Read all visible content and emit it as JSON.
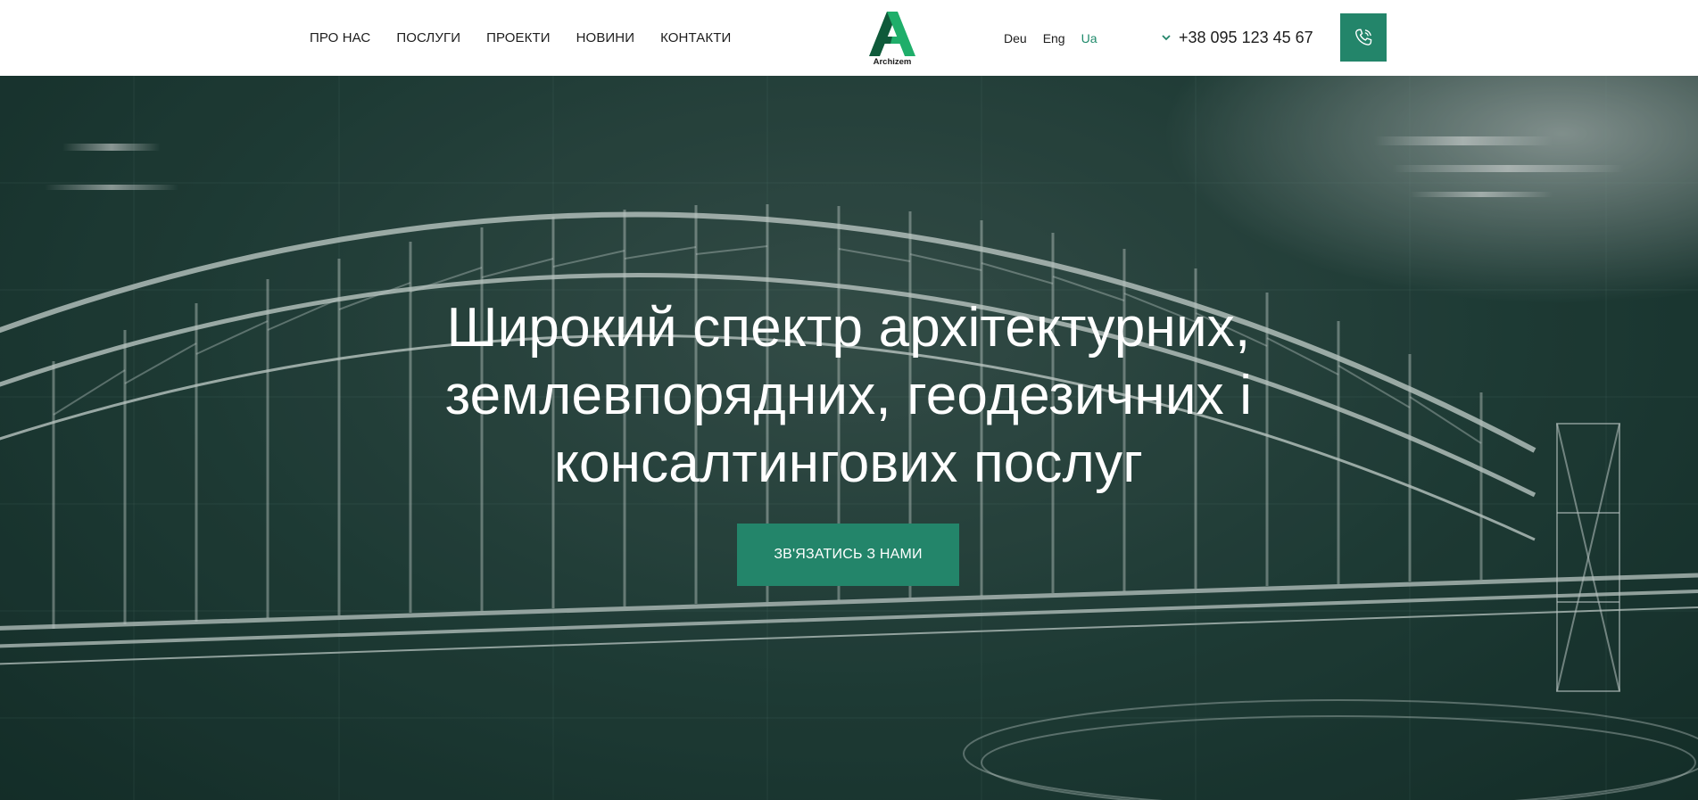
{
  "nav": {
    "items": [
      {
        "label": "ПРО НАС"
      },
      {
        "label": "ПОСЛУГИ"
      },
      {
        "label": "ПРОЕКТИ"
      },
      {
        "label": "НОВИНИ"
      },
      {
        "label": "КОНТАКТИ"
      }
    ]
  },
  "logo": {
    "text": "Archizem",
    "colors": {
      "dark": "#0f5a3a",
      "light": "#1fae6a"
    }
  },
  "languages": {
    "items": [
      {
        "label": "Deu"
      },
      {
        "label": "Eng"
      },
      {
        "label": "Ua"
      }
    ],
    "active": "Ua"
  },
  "contact": {
    "phone": "+38 095 123 45 67",
    "call_icon": "phone-icon",
    "dropdown_icon": "chevron-down-icon"
  },
  "hero": {
    "title": "Широкий спектр архітектурних, землевпорядних, геодезичних і консалтингових послуг",
    "cta_label": "ЗВ'ЯЗАТИСЬ З НАМИ"
  },
  "colors": {
    "accent": "#23856a",
    "active_lang": "#1f8a6b",
    "hero_bg": "#22403a",
    "text": "#1d1d1d"
  }
}
